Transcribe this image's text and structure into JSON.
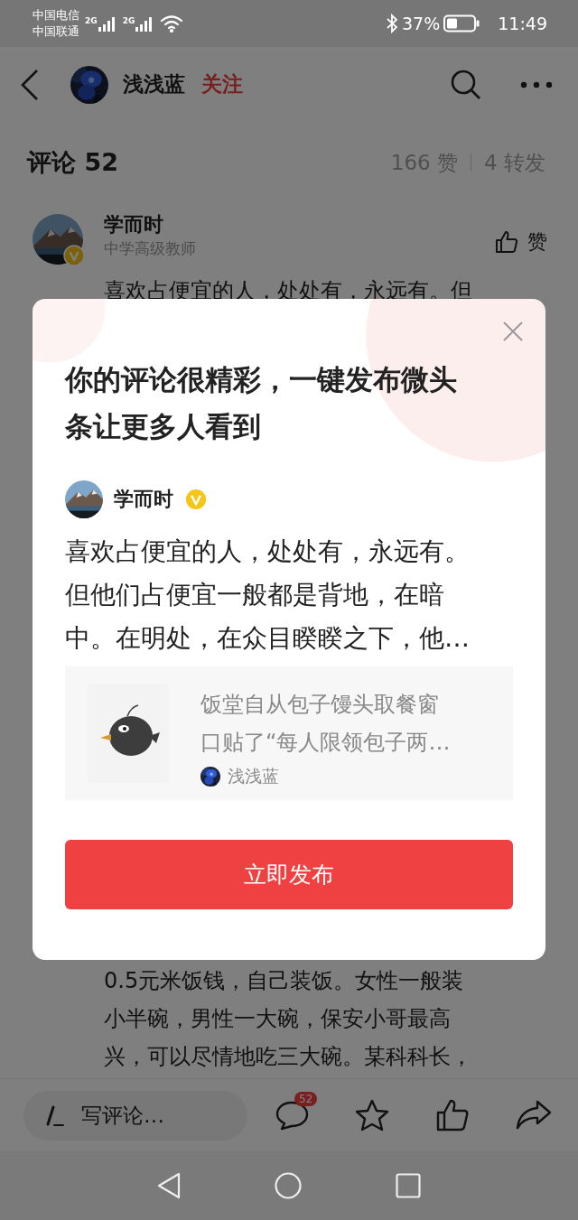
{
  "status_bar": {
    "carriers": [
      "中国电信",
      "中国联通"
    ],
    "network_labels": [
      "2G",
      "2G"
    ],
    "battery": "37%",
    "time": "11:49"
  },
  "header": {
    "author": "浅浅蓝",
    "follow": "关注"
  },
  "comments_header": {
    "title": "评论 52",
    "likes": "166 赞",
    "reposts": "4 转发"
  },
  "comment": {
    "name": "学而时",
    "subtitle": "中学高级教师",
    "like_label": "赞",
    "lines": [
      "喜欢占便宜的人，处处有，永远有。但",
      "0.5元米饭钱，自己装饭。女性一般装",
      "小半碗，男性一大碗，保安小哥最高",
      "兴，可以尽情地吃三大碗。某科科长，"
    ]
  },
  "dialog": {
    "title": "你的评论很精彩，一键发布微头条让更多人看到",
    "author": "学而时",
    "verified": true,
    "body": "喜欢占便宜的人，处处有，永远有。但他们占便宜一般都是背地，在暗中。在明处，在众目睽睽之下，他…",
    "quote": {
      "text": "饭堂自从包子馒头取餐窗口贴了“每人限领包子两…",
      "author": "浅浅蓝"
    },
    "button": "立即发布"
  },
  "bottom_bar": {
    "placeholder": "写评论…",
    "comment_count": "52"
  }
}
